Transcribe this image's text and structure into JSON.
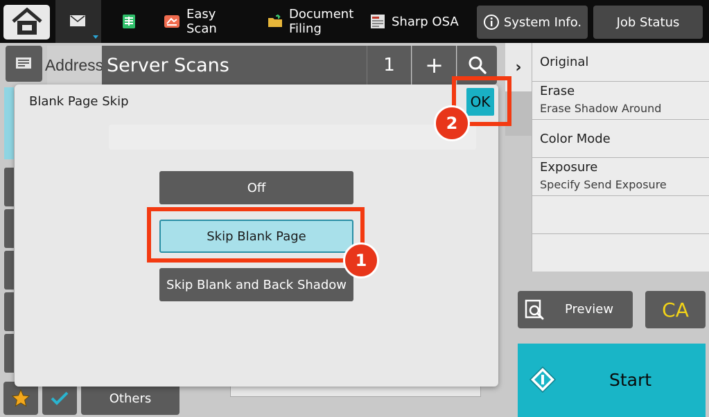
{
  "topbar": {
    "apps": [
      {
        "label": "Easy\nScan",
        "icon": "easy-scan-icon"
      },
      {
        "label": "Document\nFiling",
        "icon": "document-filing-icon"
      },
      {
        "label": "Sharp OSA",
        "icon": "sharp-osa-icon"
      }
    ],
    "system_info_label": "System Info.",
    "job_status_label": "Job Status"
  },
  "address": {
    "label": "Address",
    "value": "Server Scans",
    "count": "1",
    "add_symbol": "+"
  },
  "dialog": {
    "title": "Blank Page Skip",
    "ok_label": "OK",
    "options": [
      {
        "label": "Off",
        "selected": false
      },
      {
        "label": "Skip Blank Page",
        "selected": true
      },
      {
        "label": "Skip Blank and Back Shadow",
        "selected": false
      }
    ]
  },
  "panel": {
    "items": [
      {
        "title": "Original",
        "sub": ""
      },
      {
        "title": "Erase",
        "sub": "Erase Shadow Around"
      },
      {
        "title": "Color Mode",
        "sub": ""
      },
      {
        "title": "Exposure",
        "sub": "Specify Send Exposure"
      }
    ]
  },
  "actions": {
    "preview_label": "Preview",
    "ca_label": "CA",
    "start_label": "Start",
    "others_label": "Others"
  },
  "annotations": {
    "step1": "1",
    "step2": "2",
    "color": "#f33a11"
  },
  "colors": {
    "accent": "#19b5c7",
    "selected_option": "#a8e0ea",
    "ca_text": "#f2d318"
  }
}
